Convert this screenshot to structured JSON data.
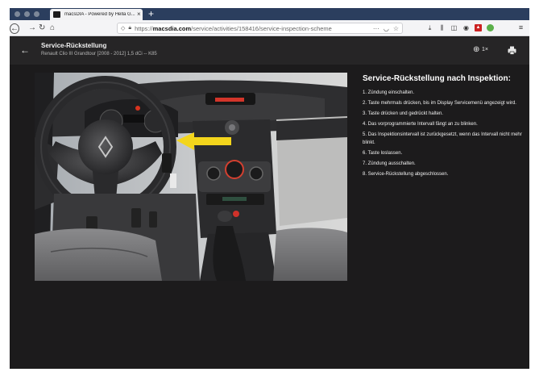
{
  "browser": {
    "tab_title": "macsDIA - Powered by Hella G...",
    "tab_close": "×",
    "new_tab": "+",
    "url_scheme": "https://",
    "url_domain": "macsdia.com",
    "url_path": "/service/activities/158416/service-inspection-scheme",
    "url_more": "···",
    "icons": [
      "back-icon",
      "forward-icon",
      "reload-icon",
      "home-icon",
      "shield-icon",
      "lock-icon",
      "pocket-icon",
      "bookmark-star-icon",
      "download-icon",
      "library-icon",
      "sidebar-icon",
      "account-icon",
      "pdf-icon",
      "extension-icon",
      "menu-icon"
    ]
  },
  "header": {
    "title": "Service-Rückstellung",
    "subtitle": "Renault Clio III Grandtour [2008 - 2012] 1,5 dCi -- K85",
    "zoom_level": "1×"
  },
  "instructions": {
    "title": "Service-Rückstellung nach Inspektion:",
    "steps": [
      "1. Zündung einschalten.",
      "2. Taste mehrmals drücken, bis im Display Servicemenü angezeigt wird.",
      "3. Taste drücken und gedrückt halten.",
      "4. Das vorprogrammierte Intervall fängt an zu blinken.",
      "5. Das Inspektionsintervall ist zurückgesetzt, wenn das Intervall nicht mehr blinkt.",
      "6. Taste loslassen.",
      "7. Zündung ausschalten.",
      "8. Service-Rückstellung abgeschlossen."
    ]
  },
  "colors": {
    "tabbar": "#2b3e5e",
    "page_background": "#1c1b1c",
    "header_background": "#262526",
    "arrow": "#f3d51c"
  }
}
